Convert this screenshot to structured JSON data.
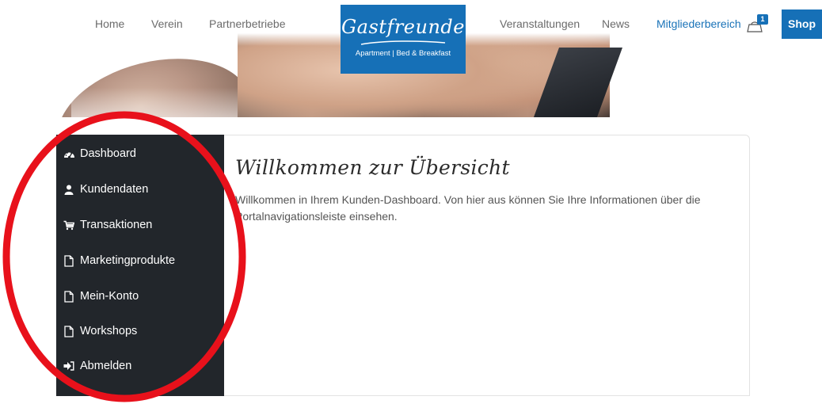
{
  "nav": {
    "left": [
      {
        "label": "Home"
      },
      {
        "label": "Verein"
      },
      {
        "label": "Partnerbetriebe"
      }
    ],
    "right": [
      {
        "label": "Veranstaltungen"
      },
      {
        "label": "News"
      },
      {
        "label": "Mitgliederbereich",
        "active": true
      }
    ],
    "cart_count": "1",
    "shop_label": "Shop"
  },
  "logo": {
    "name": "Gastfreunde",
    "tagline": "Apartment | Bed & Breakfast"
  },
  "sidebar": {
    "items": [
      {
        "label": "Dashboard",
        "icon": "dashboard-icon"
      },
      {
        "label": "Kundendaten",
        "icon": "user-icon"
      },
      {
        "label": "Transaktionen",
        "icon": "cart-icon"
      },
      {
        "label": "Marketingprodukte",
        "icon": "file-icon"
      },
      {
        "label": "Mein-Konto",
        "icon": "file-icon"
      },
      {
        "label": "Workshops",
        "icon": "file-icon"
      },
      {
        "label": "Abmelden",
        "icon": "logout-icon"
      }
    ]
  },
  "main": {
    "title": "Willkommen zur Übersicht",
    "text": "Willkommen in Ihrem Kunden-Dashboard. Von hier aus können Sie Ihre Informationen über die Portalnavigationsleiste einsehen."
  },
  "colors": {
    "brand_blue": "#1670b7",
    "sidebar_bg": "#22262b",
    "annotation_red": "#e8111b"
  }
}
